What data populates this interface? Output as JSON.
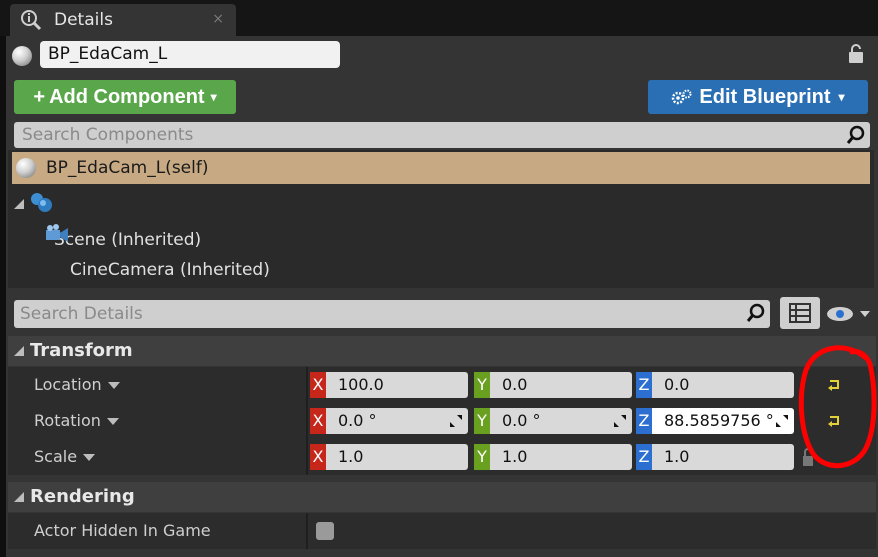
{
  "tab": {
    "title": "Details",
    "close": "×",
    "icon": "details-info-icon"
  },
  "actor": {
    "name": "BP_EdaCam_L",
    "icon": "actor-sphere-icon",
    "lock_icon": "lock-icon"
  },
  "toolbar": {
    "add_component_icon": "+",
    "add_component_label": "Add Component",
    "edit_blueprint_label": "Edit Blueprint",
    "caret": "▾"
  },
  "component_search": {
    "placeholder": "Search Components"
  },
  "components": {
    "self_label": "BP_EdaCam_L(self)",
    "items": [
      {
        "label": "Scene (Inherited)",
        "icon": "scene-icon"
      },
      {
        "label": "CineCamera (Inherited)",
        "icon": "camera-icon"
      }
    ]
  },
  "details_search": {
    "placeholder": "Search Details"
  },
  "sections": {
    "transform": {
      "title": "Transform",
      "location": {
        "label": "Location",
        "x": "100.0",
        "y": "0.0",
        "z": "0.0"
      },
      "rotation": {
        "label": "Rotation",
        "x": "0.0 °",
        "y": "0.0 °",
        "z": "88.5859756 °"
      },
      "scale": {
        "label": "Scale",
        "x": "1.0",
        "y": "1.0",
        "z": "1.0"
      }
    },
    "rendering": {
      "title": "Rendering",
      "actor_hidden": {
        "label": "Actor Hidden In Game",
        "checked": false
      }
    }
  },
  "axes": {
    "x": "X",
    "y": "Y",
    "z": "Z"
  },
  "colors": {
    "add_button": "#5aa64a",
    "edit_button": "#2a6fb4",
    "axis_x": "#c7271a",
    "axis_y": "#6aa01f",
    "axis_z": "#2c6fd1",
    "selection": "#c7a983",
    "annotation": "#ff0000",
    "reset_arrow": "#e2d23a"
  }
}
